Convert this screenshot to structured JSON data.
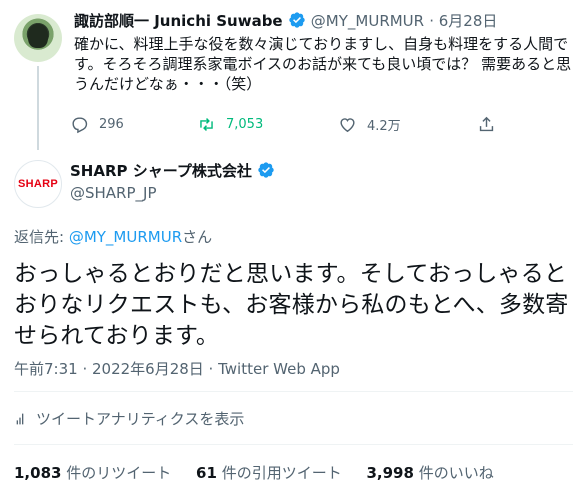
{
  "parent_tweet": {
    "display_name": "諏訪部順一 Junichi Suwabe",
    "handle": "@MY_MURMUR",
    "date": "6月28日",
    "text_lines": [
      "確かに、料理上手な役を数々演じておりますし、自身も料理をする人間で",
      "す。そろそろ調理系家電ボイスのお話が来ても良い頃では？ 需要あると思",
      "うんだけどなぁ・・・（笑）"
    ],
    "reply_count": "296",
    "retweet_count": "7,053",
    "like_count": "4.2万"
  },
  "main_tweet": {
    "display_name": "SHARP シャープ株式会社",
    "handle": "@SHARP_JP",
    "avatar_logo": "SHARP",
    "reply_to_label": "返信先: ",
    "reply_to_handle": "@MY_MURMUR",
    "reply_to_suffix": "さん",
    "text_lines": [
      "おっしゃるとおりだと思います。そしておっしゃると",
      "おりなリクエストも、お客様から私のもとへ、多数寄",
      "せられております。"
    ],
    "timestamp": "午前7:31 · 2022年6月28日 · Twitter Web App",
    "analytics_label": "ツイートアナリティクスを表示"
  },
  "stats": {
    "retweets_value": "1,083",
    "retweets_label": "件のリツイート",
    "quotes_value": "61",
    "quotes_label": "件の引用ツイート",
    "likes_value": "3,998",
    "likes_label": "件のいいね"
  },
  "colors": {
    "accent": "#1d9bf0",
    "retweet_green": "#00ba7c",
    "muted_text": "#536471",
    "sharp_red": "#e60012"
  },
  "icons": [
    "reply-icon",
    "retweet-icon",
    "like-icon",
    "share-icon",
    "verified-badge-icon",
    "analytics-icon"
  ]
}
